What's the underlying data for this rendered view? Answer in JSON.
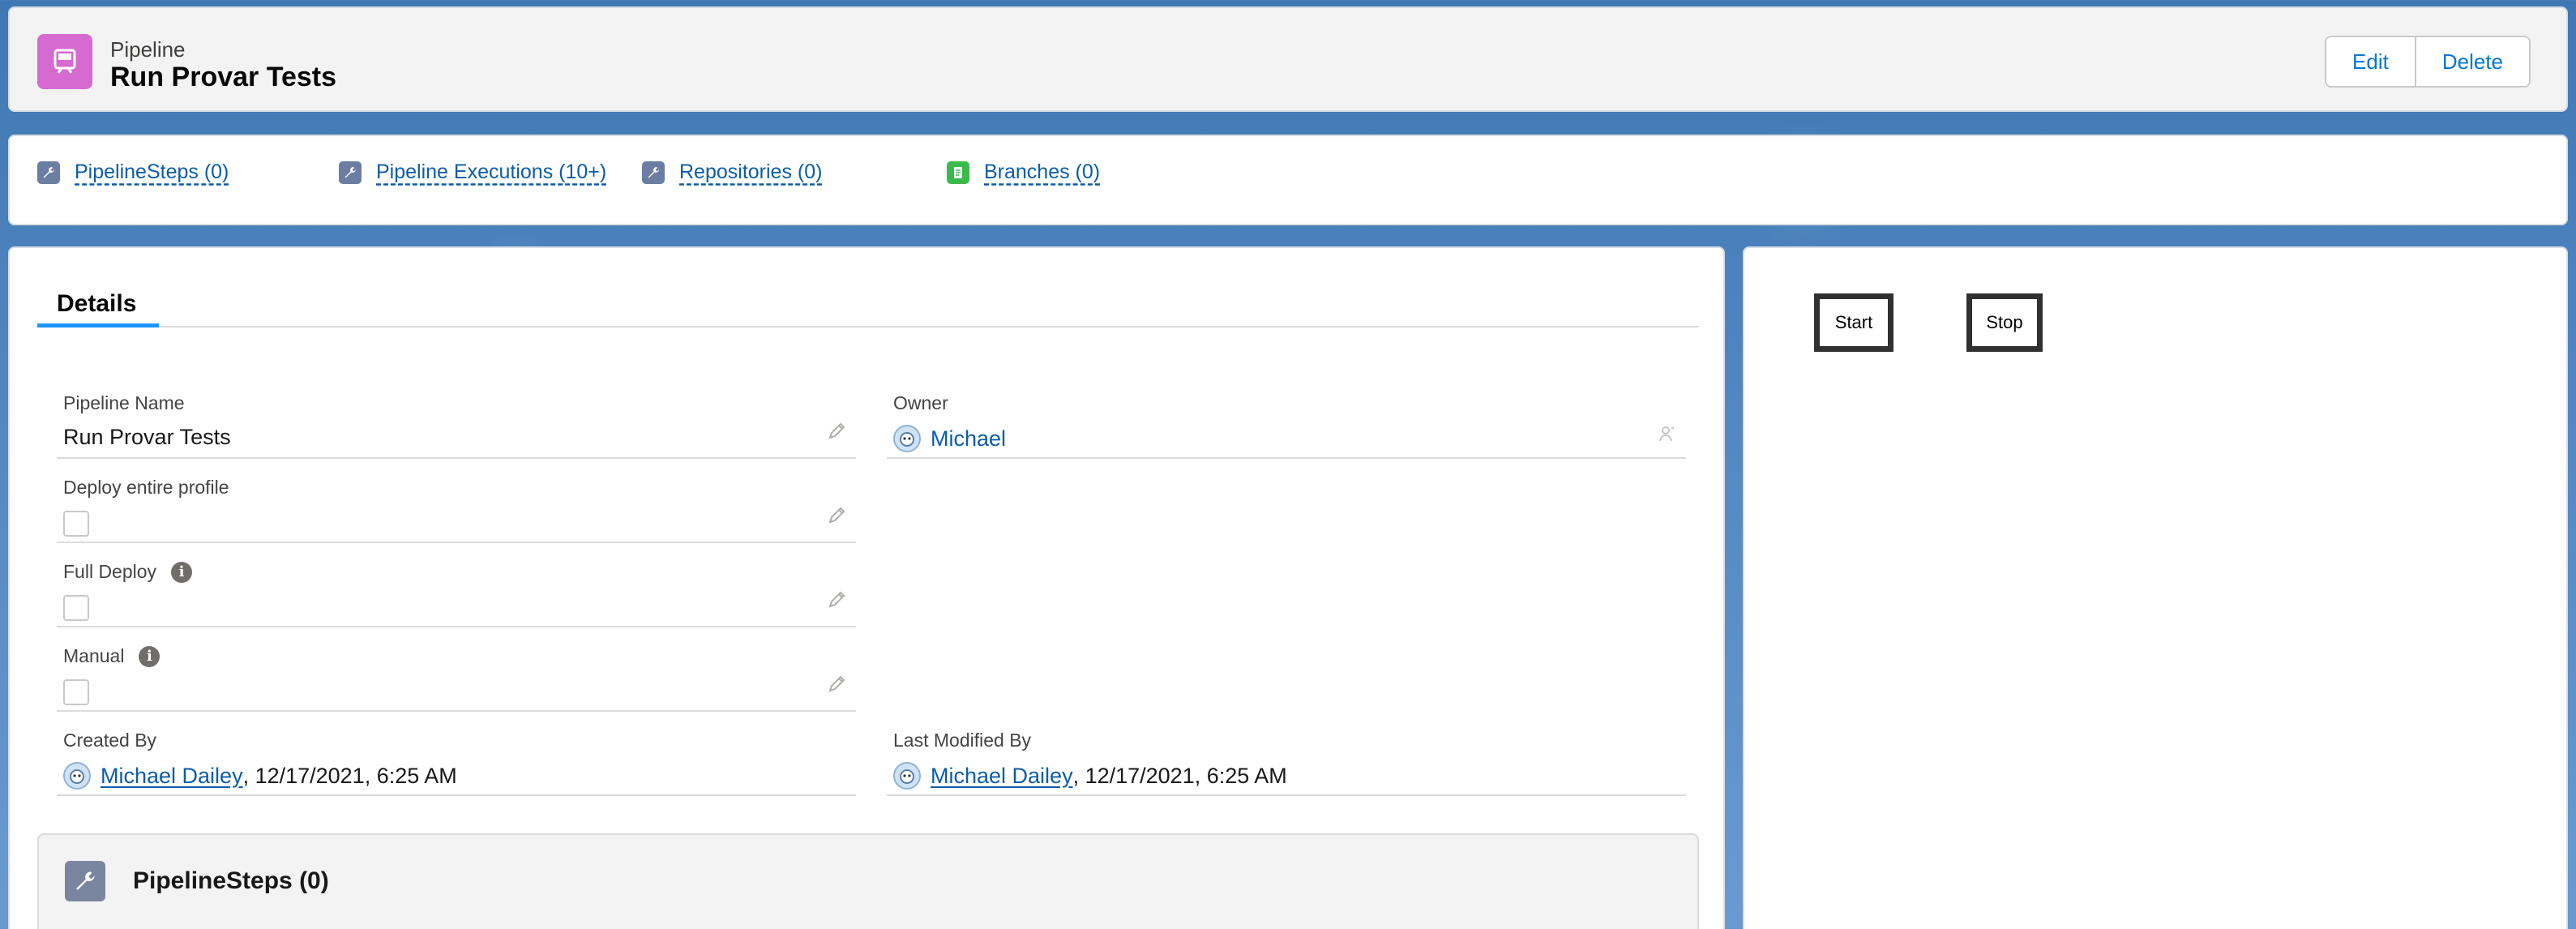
{
  "header": {
    "object_type": "Pipeline",
    "record_title": "Run Provar Tests",
    "icon": "pipeline-icon",
    "icon_color": "#d66ad0",
    "actions": {
      "edit": "Edit",
      "delete": "Delete"
    }
  },
  "quick_links": [
    {
      "label": "PipelineSteps (0)",
      "icon": "wrench-icon",
      "color": "#6b7da0"
    },
    {
      "label": "Pipeline Executions (10+)",
      "icon": "wrench-icon",
      "color": "#6b7da0"
    },
    {
      "label": "Repositories (0)",
      "icon": "wrench-icon",
      "color": "#6b7da0"
    },
    {
      "label": "Branches (0)",
      "icon": "document-icon",
      "color": "#3bba4c"
    }
  ],
  "details": {
    "tab_label": "Details",
    "pipeline_name_label": "Pipeline Name",
    "pipeline_name_value": "Run Provar Tests",
    "owner_label": "Owner",
    "owner_value": "Michael",
    "deploy_profile_label": "Deploy entire profile",
    "full_deploy_label": "Full Deploy",
    "manual_label": "Manual",
    "info_glyph": "i",
    "created_by_label": "Created By",
    "created_by_name": "Michael Dailey",
    "created_by_date": ", 12/17/2021, 6:25 AM",
    "last_modified_label": "Last Modified By",
    "last_modified_name": "Michael Dailey",
    "last_modified_date": ", 12/17/2021, 6:25 AM"
  },
  "related": {
    "title": "PipelineSteps (0)",
    "icon": "wrench-icon"
  },
  "controls": {
    "start_label": "Start",
    "stop_label": "Stop"
  },
  "colors": {
    "link": "#0b5cab",
    "tab_accent": "#1b96ff"
  }
}
